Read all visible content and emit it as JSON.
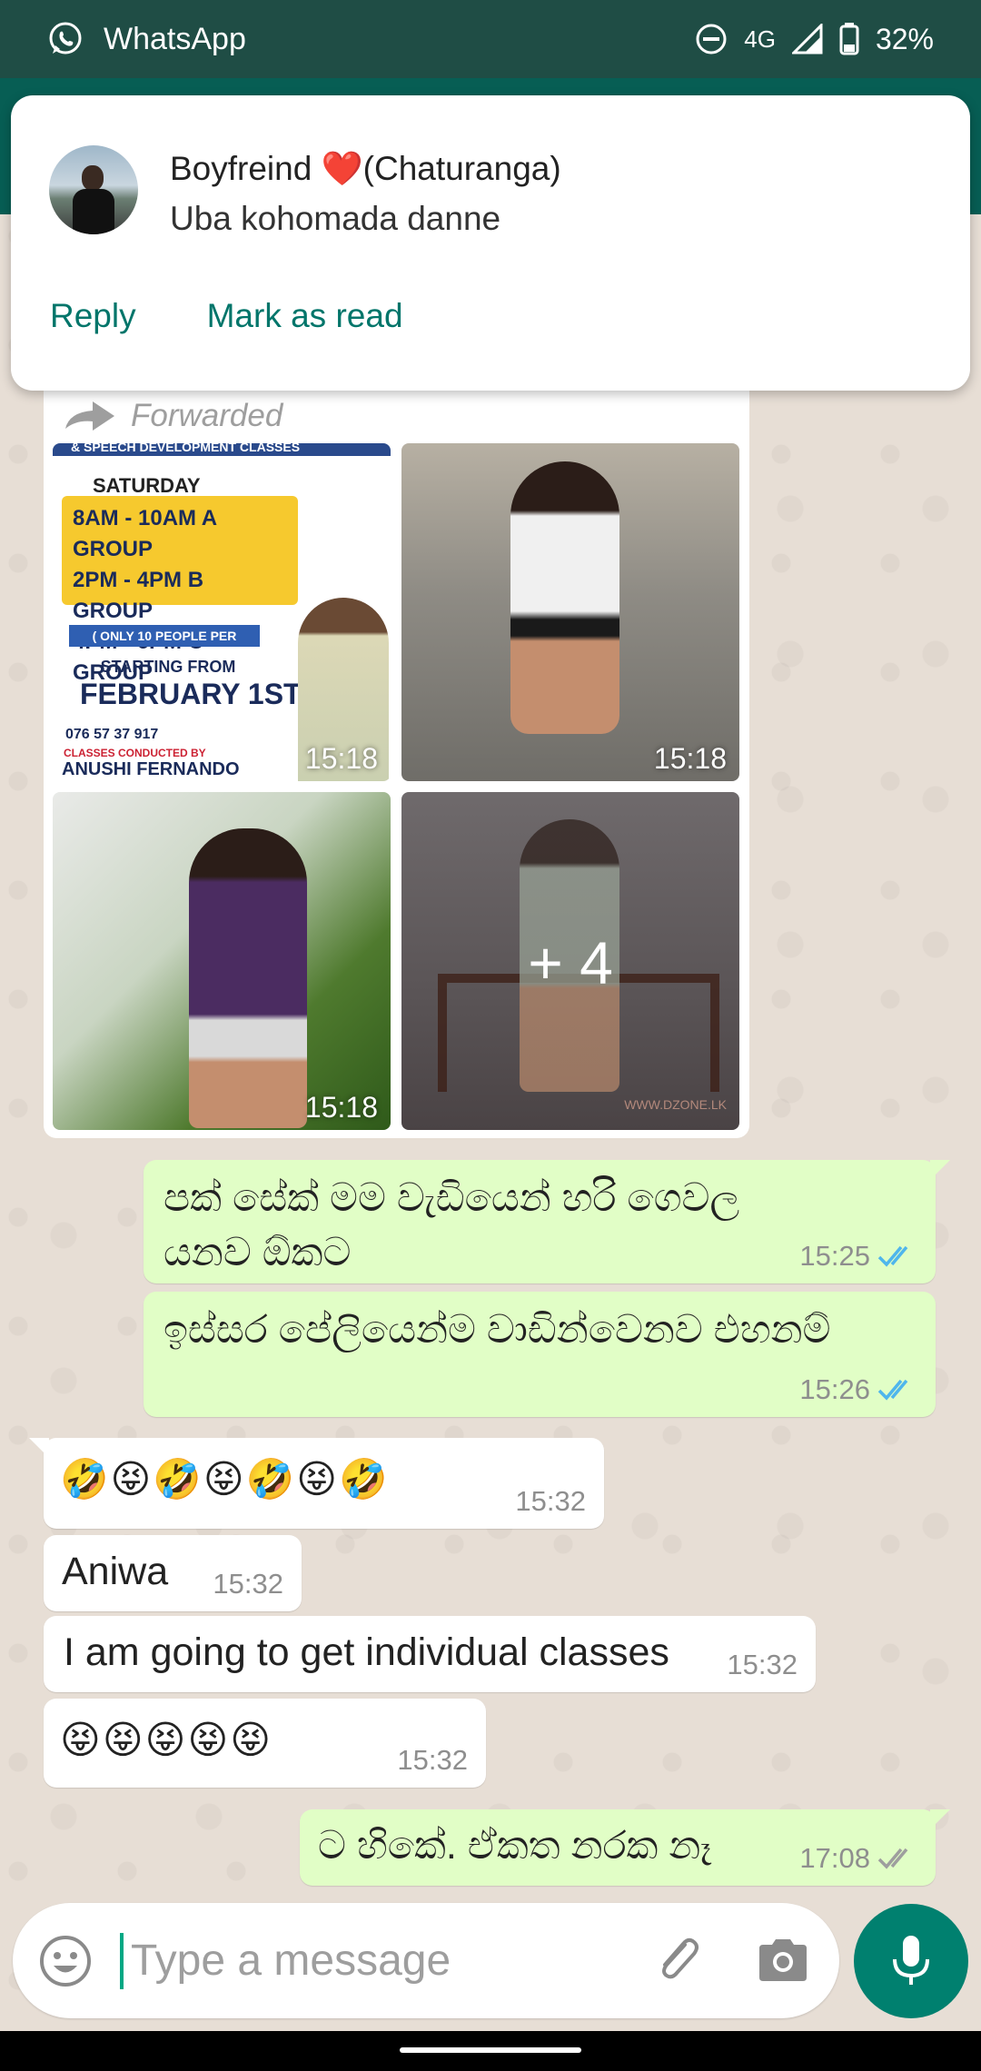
{
  "status_bar": {
    "app_name": "WhatsApp",
    "network": "4G",
    "battery": "32%"
  },
  "notification": {
    "sender": "Boyfreind",
    "sender_heart": "❤️",
    "sender_suffix": "(Chaturanga)",
    "message": "Uba kohomada danne",
    "actions": {
      "reply": "Reply",
      "mark_read": "Mark as read"
    }
  },
  "album": {
    "forwarded_label": "Forwarded",
    "tiles": [
      {
        "time": "15:18"
      },
      {
        "time": "15:18"
      },
      {
        "time": "15:18"
      },
      {
        "more": "+ 4"
      }
    ],
    "flyer": {
      "header": "& SPEECH DEVELOPMENT CLASSES",
      "day": "SATURDAY",
      "slots": [
        "8AM - 10AM  A GROUP",
        "2PM - 4PM   B GROUP",
        "4PM - 6PM   C GROUP"
      ],
      "limit": "( ONLY 10 PEOPLE PER GROUP )",
      "starting": "STARTING FROM",
      "date": "FEBRUARY 1ST",
      "phone": "076 57 37 917",
      "conducted": "CLASSES CONDUCTED BY",
      "teacher": "ANUSHI FERNANDO"
    },
    "watermark": "WWW.DZONE.LK"
  },
  "messages": [
    {
      "direction": "out",
      "text": "පක් සේක් මම වැඩියෙන් හරි ගෙවල යනව ඕකට",
      "time": "15:25",
      "status": "read"
    },
    {
      "direction": "out",
      "text": "ඉස්සර  පේලියෙන්ම වාඩින්වෙනව එහනම්",
      "time": "15:26",
      "status": "read"
    },
    {
      "direction": "in",
      "text": "🤣😝🤣😝🤣😝🤣",
      "time": "15:32"
    },
    {
      "direction": "in",
      "text": "Aniwa",
      "time": "15:32"
    },
    {
      "direction": "in",
      "text": "I am going to get individual classes",
      "time": "15:32"
    },
    {
      "direction": "in",
      "text": "😝😝😝😝😝",
      "time": "15:32"
    },
    {
      "direction": "out",
      "text": "ට හිකේ. ඒකත නරක නෑ",
      "time": "17:08",
      "status": "delivered"
    }
  ],
  "input": {
    "placeholder": "Type a message"
  },
  "colors": {
    "header": "#075e54",
    "status_bar": "#1f4d45",
    "outgoing_bubble": "#e1fec6",
    "incoming_bubble": "#ffffff",
    "read_ticks": "#4fb6ec",
    "mic_button": "#00806f",
    "notif_action": "#00756a"
  }
}
